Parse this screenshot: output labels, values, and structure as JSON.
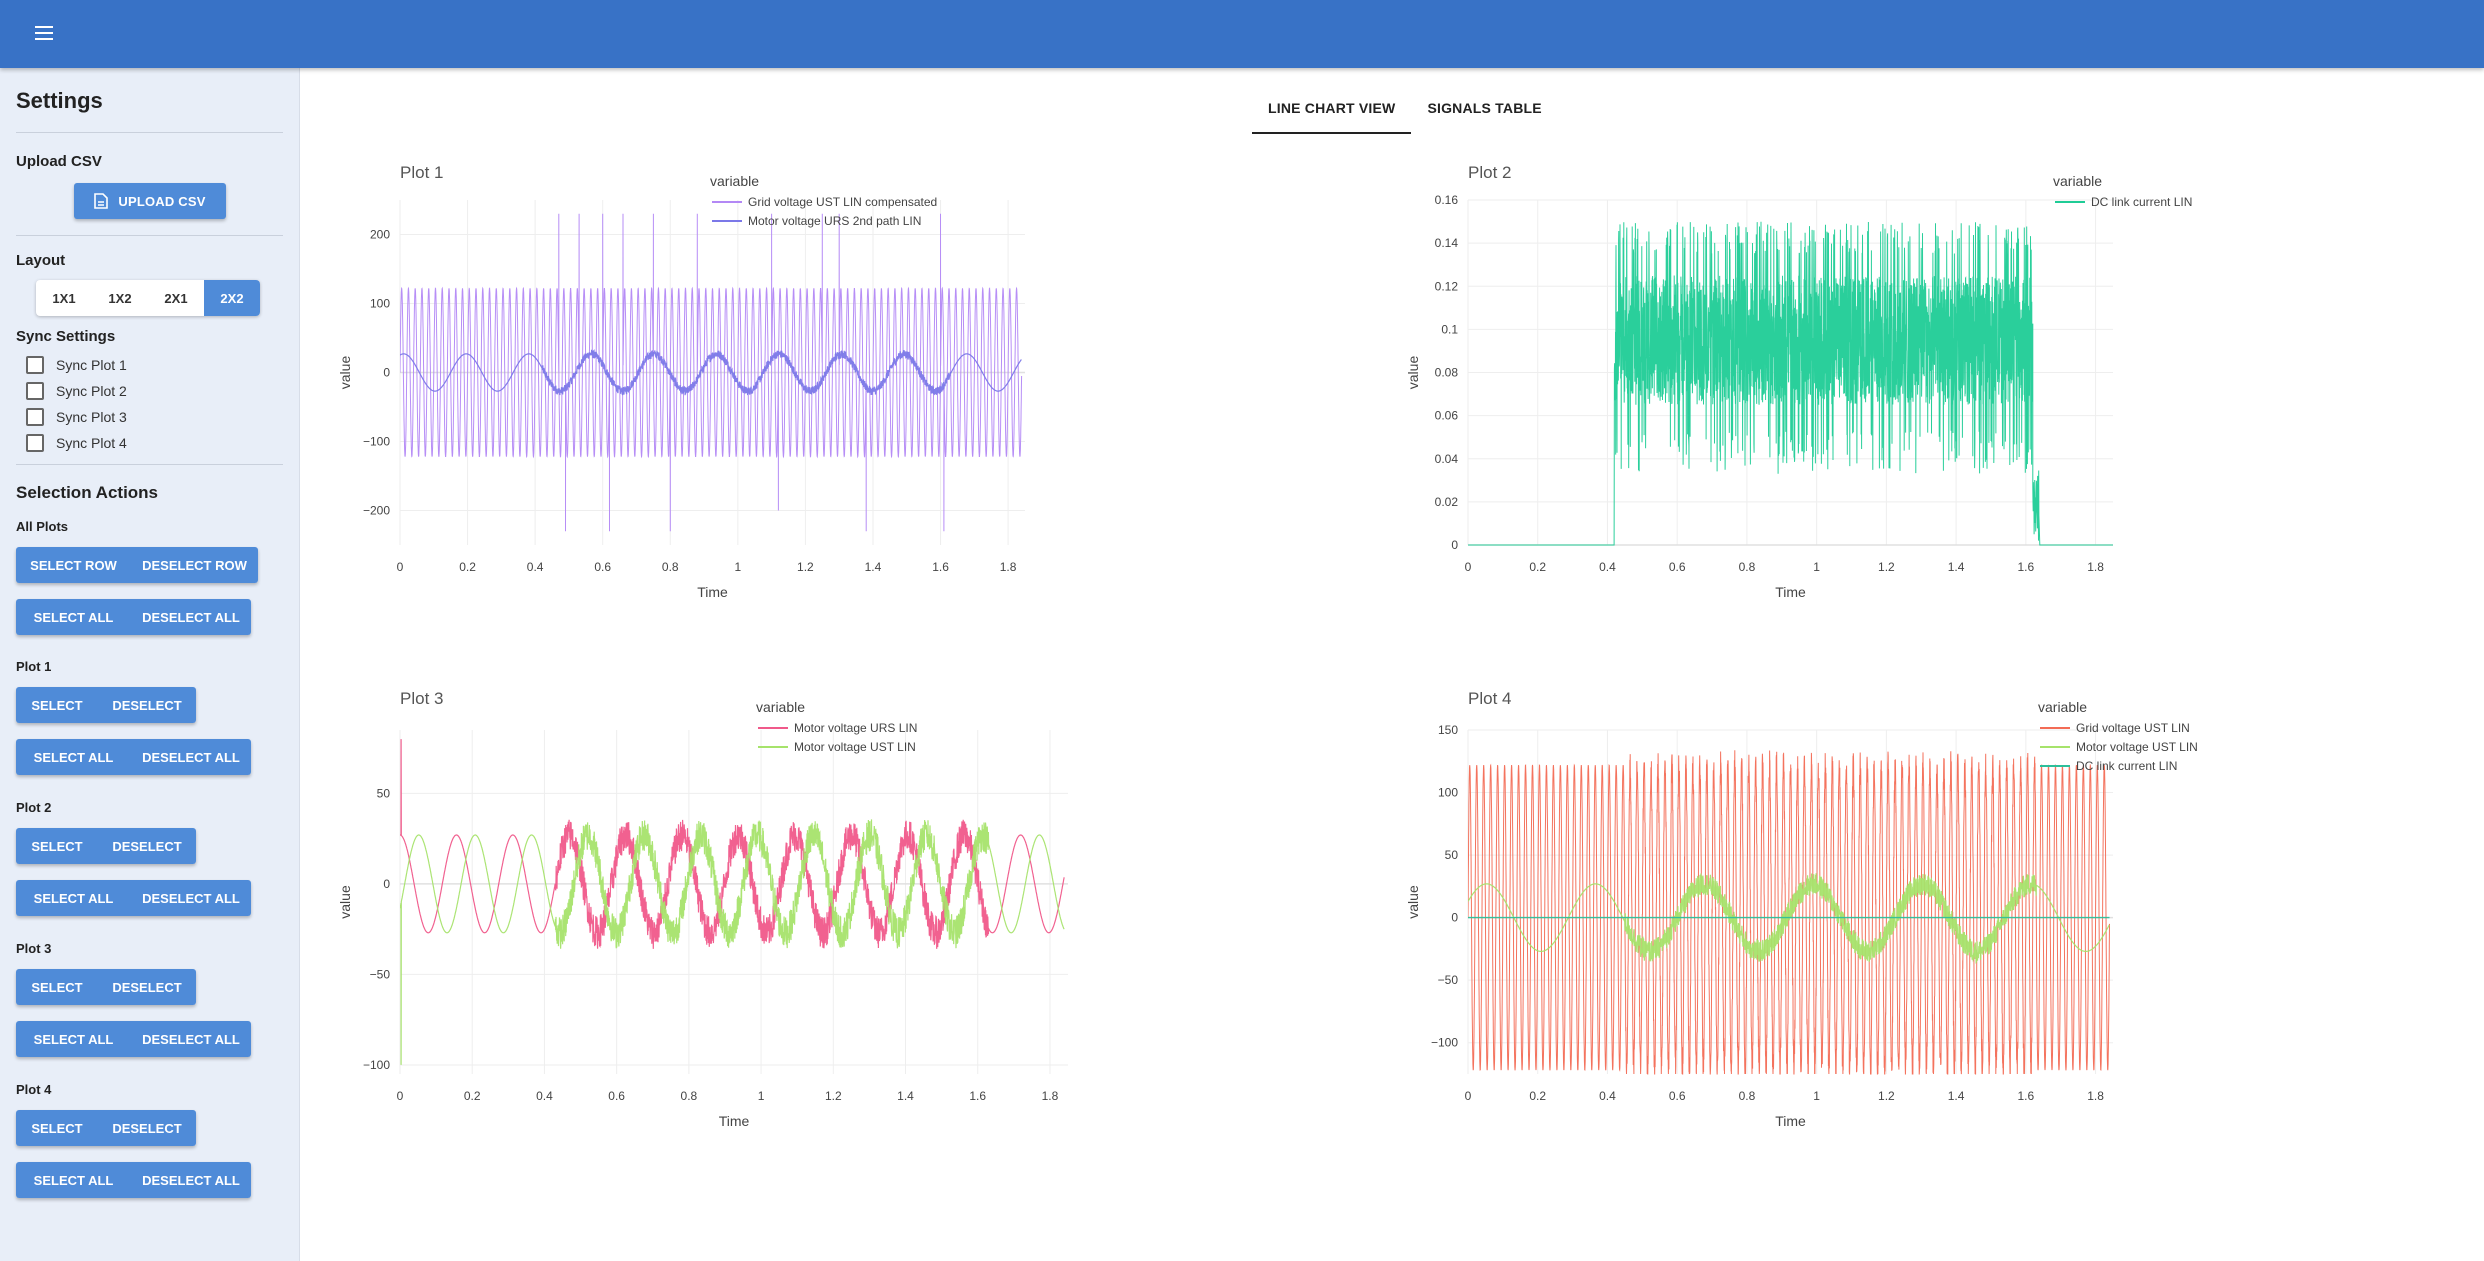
{
  "header": {
    "menu_icon": "hamburger-menu-icon"
  },
  "sidebar": {
    "title": "Settings",
    "upload": {
      "heading": "Upload CSV",
      "button": "UPLOAD CSV",
      "icon": "file-upload-icon"
    },
    "layout": {
      "heading": "Layout",
      "options": [
        "1X1",
        "1X2",
        "2X1",
        "2X2"
      ],
      "selected": "2X2"
    },
    "sync": {
      "heading": "Sync Settings",
      "items": [
        "Sync Plot 1",
        "Sync Plot 2",
        "Sync Plot 3",
        "Sync Plot 4"
      ]
    },
    "selection": {
      "heading": "Selection Actions",
      "all_plots": {
        "label": "All Plots",
        "select_row": "SELECT ROW",
        "deselect_row": "DESELECT ROW",
        "select_all": "SELECT ALL",
        "deselect_all": "DESELECT ALL"
      },
      "plots": [
        {
          "label": "Plot 1",
          "select": "SELECT",
          "deselect": "DESELECT",
          "select_all": "SELECT ALL",
          "deselect_all": "DESELECT ALL"
        },
        {
          "label": "Plot 2",
          "select": "SELECT",
          "deselect": "DESELECT",
          "select_all": "SELECT ALL",
          "deselect_all": "DESELECT ALL"
        },
        {
          "label": "Plot 3",
          "select": "SELECT",
          "deselect": "DESELECT",
          "select_all": "SELECT ALL",
          "deselect_all": "DESELECT ALL"
        },
        {
          "label": "Plot 4",
          "select": "SELECT",
          "deselect": "DESELECT",
          "select_all": "SELECT ALL",
          "deselect_all": "DESELECT ALL"
        }
      ]
    }
  },
  "tabs": [
    {
      "label": "LINE CHART VIEW",
      "active": true
    },
    {
      "label": "SIGNALS TABLE",
      "active": false
    }
  ],
  "chart_data": [
    {
      "type": "line",
      "title": "Plot 1",
      "xlabel": "Time",
      "ylabel": "value",
      "legend_title": "variable",
      "legend_position": "top-right",
      "xlim": [
        0,
        1.85
      ],
      "ylim": [
        -250,
        250
      ],
      "xticks": [
        0,
        0.2,
        0.4,
        0.6,
        0.8,
        1,
        1.2,
        1.4,
        1.6,
        1.8
      ],
      "xtick_labels": [
        "0",
        "0.2",
        "0.4",
        "0.6",
        "0.8",
        "1",
        "1.2",
        "1.4",
        "1.6",
        "1.8"
      ],
      "yticks": [
        -200,
        -100,
        0,
        100,
        200
      ],
      "ytick_labels": [
        "−200",
        "−100",
        "0",
        "100",
        "200"
      ],
      "series": [
        {
          "name": "Grid voltage UST LIN compensated",
          "color": "#b388f5",
          "kind": "sine",
          "amplitude": 122,
          "cycles_per_unit": 50,
          "phase": 0.0,
          "noise_after": 0.42,
          "noise": 0,
          "spikes": [
            [
              0.47,
              230
            ],
            [
              0.49,
              -230
            ],
            [
              0.53,
              230
            ],
            [
              0.6,
              230
            ],
            [
              0.62,
              -230
            ],
            [
              0.66,
              230
            ],
            [
              0.75,
              230
            ],
            [
              0.8,
              -230
            ],
            [
              0.88,
              230
            ],
            [
              1.1,
              230
            ],
            [
              1.12,
              -200
            ],
            [
              1.25,
              230
            ],
            [
              1.3,
              230
            ],
            [
              1.38,
              -230
            ],
            [
              1.6,
              230
            ],
            [
              1.61,
              -230
            ]
          ],
          "width": 1
        },
        {
          "name": "Motor voltage URS 2nd path LIN",
          "color": "#7b78e8",
          "kind": "sine",
          "amplitude": 27,
          "cycles_per_unit": 5.4,
          "phase": 1.2,
          "noise_after": 0.42,
          "noise": 6,
          "spikes": [],
          "width": 1.2
        }
      ]
    },
    {
      "type": "line",
      "title": "Plot 2",
      "xlabel": "Time",
      "ylabel": "value",
      "legend_title": "variable",
      "legend_position": "top-right",
      "xlim": [
        0,
        1.85
      ],
      "ylim": [
        0,
        0.16
      ],
      "xticks": [
        0,
        0.2,
        0.4,
        0.6,
        0.8,
        1,
        1.2,
        1.4,
        1.6,
        1.8
      ],
      "xtick_labels": [
        "0",
        "0.2",
        "0.4",
        "0.6",
        "0.8",
        "1",
        "1.2",
        "1.4",
        "1.6",
        "1.8"
      ],
      "yticks": [
        0,
        0.02,
        0.04,
        0.06,
        0.08,
        0.1,
        0.12,
        0.14,
        0.16
      ],
      "ytick_labels": [
        "0",
        "0.02",
        "0.04",
        "0.06",
        "0.08",
        "0.1",
        "0.12",
        "0.14",
        "0.16"
      ],
      "series": [
        {
          "name": "DC link current LIN",
          "color": "#1fcc96",
          "kind": "noisy_step",
          "start": 0.42,
          "end": 1.62,
          "base": 0.095,
          "spread": 0.03,
          "peak": 0.15,
          "trough": 0.033,
          "width": 1
        }
      ]
    },
    {
      "type": "line",
      "title": "Plot 3",
      "xlabel": "Time",
      "ylabel": "value",
      "legend_title": "variable",
      "legend_position": "top-right",
      "xlim": [
        0,
        1.85
      ],
      "ylim": [
        -105,
        85
      ],
      "xticks": [
        0,
        0.2,
        0.4,
        0.6,
        0.8,
        1,
        1.2,
        1.4,
        1.6,
        1.8
      ],
      "xtick_labels": [
        "0",
        "0.2",
        "0.4",
        "0.6",
        "0.8",
        "1",
        "1.2",
        "1.4",
        "1.6",
        "1.8"
      ],
      "yticks": [
        -100,
        -50,
        0,
        50
      ],
      "ytick_labels": [
        "−100",
        "−50",
        "0",
        "50"
      ],
      "series": [
        {
          "name": "Motor voltage URS LIN",
          "color": "#f0598a",
          "kind": "sine",
          "amplitude": 27,
          "cycles_per_unit": 6.4,
          "phase": 1.57,
          "noise_after": 0.43,
          "noise": 9,
          "spikes": [
            [
              0.003,
              80
            ]
          ],
          "width": 1.2
        },
        {
          "name": "Motor voltage UST LIN",
          "color": "#a6e36b",
          "kind": "sine",
          "amplitude": 27,
          "cycles_per_unit": 6.4,
          "phase": -0.52,
          "noise_after": 0.43,
          "noise": 9,
          "spikes": [
            [
              0.003,
              -100
            ]
          ],
          "width": 1.2
        }
      ]
    },
    {
      "type": "line",
      "title": "Plot 4",
      "xlabel": "Time",
      "ylabel": "value",
      "legend_title": "variable",
      "legend_position": "top-right",
      "xlim": [
        0,
        1.85
      ],
      "ylim": [
        -125,
        150
      ],
      "xticks": [
        0,
        0.2,
        0.4,
        0.6,
        0.8,
        1,
        1.2,
        1.4,
        1.6,
        1.8
      ],
      "xtick_labels": [
        "0",
        "0.2",
        "0.4",
        "0.6",
        "0.8",
        "1",
        "1.2",
        "1.4",
        "1.6",
        "1.8"
      ],
      "yticks": [
        -100,
        -50,
        0,
        50,
        100,
        150
      ],
      "ytick_labels": [
        "−100",
        "−50",
        "0",
        "50",
        "100",
        "150"
      ],
      "series": [
        {
          "name": "Grid voltage UST LIN",
          "color": "#f36b55",
          "kind": "sine",
          "amplitude": 122,
          "cycles_per_unit": 50,
          "phase": 0.0,
          "noise_after": 0.45,
          "noise": 12,
          "spikes": [],
          "width": 1
        },
        {
          "name": "Motor voltage UST LIN",
          "color": "#a6e36b",
          "kind": "sine",
          "amplitude": 27,
          "cycles_per_unit": 3.2,
          "phase": 0.5,
          "noise_after": 0.45,
          "noise": 9,
          "spikes": [],
          "width": 1.2
        },
        {
          "name": "DC link current LIN",
          "color": "#2dbf9a",
          "kind": "flat",
          "value": 0,
          "width": 1.4
        }
      ]
    }
  ]
}
